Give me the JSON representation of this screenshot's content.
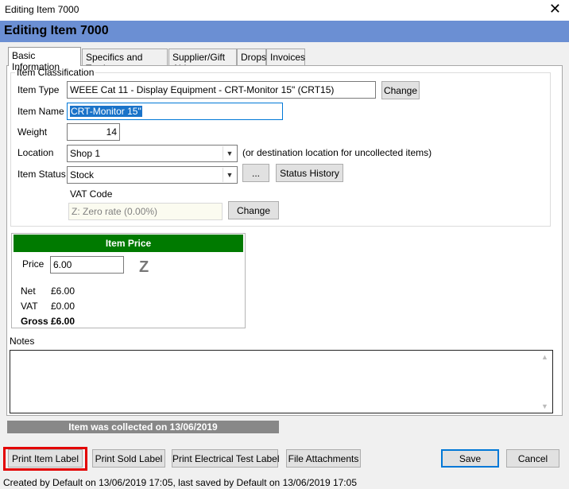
{
  "window": {
    "title": "Editing Item 7000",
    "close_glyph": "✕"
  },
  "banner": {
    "title": "Editing Item 7000"
  },
  "tabs": [
    {
      "label": "Basic Information",
      "active": true
    },
    {
      "label": "Specifics and Testing"
    },
    {
      "label": "Supplier/Gift Aid"
    },
    {
      "label": "Drops"
    },
    {
      "label": "Invoices"
    }
  ],
  "classification": {
    "group_title": "Item Classification",
    "item_type_label": "Item Type",
    "item_type_value": "WEEE Cat 11 - Display Equipment - CRT-Monitor 15\" (CRT15)",
    "change_label": "Change",
    "item_name_label": "Item Name",
    "item_name_value": "CRT-Monitor 15\"",
    "weight_label": "Weight",
    "weight_value": "14",
    "location_label": "Location",
    "location_value": "Shop 1",
    "location_note": "(or destination location for uncollected items)",
    "status_label": "Item Status",
    "status_value": "Stock",
    "ellipsis_label": "...",
    "status_history_label": "Status History",
    "vat_code_label": "VAT Code",
    "vat_code_value": "Z: Zero rate (0.00%)",
    "vat_change_label": "Change"
  },
  "price": {
    "header": "Item Price",
    "price_label": "Price",
    "price_value": "6.00",
    "vat_glyph": "Z",
    "net_label": "Net",
    "net_value": "£6.00",
    "vat_label": "VAT",
    "vat_value": "£0.00",
    "gross_label": "Gross",
    "gross_value": "£6.00",
    "header_color": "#007a00"
  },
  "notes": {
    "label": "Notes",
    "value": ""
  },
  "collected_text": "Item was collected on 13/06/2019",
  "footer_buttons": {
    "print_item_label": "Print Item Label",
    "print_sold_label": "Print Sold Label",
    "print_electrical": "Print Electrical Test Label",
    "file_attachments": "File Attachments",
    "save": "Save",
    "cancel": "Cancel"
  },
  "status_bar": "Created by Default on 13/06/2019 17:05, last saved by Default on 13/06/2019 17:05",
  "colors": {
    "banner": "#6b8fd3",
    "highlight_box": "#e30000",
    "accent": "#0078d7"
  }
}
